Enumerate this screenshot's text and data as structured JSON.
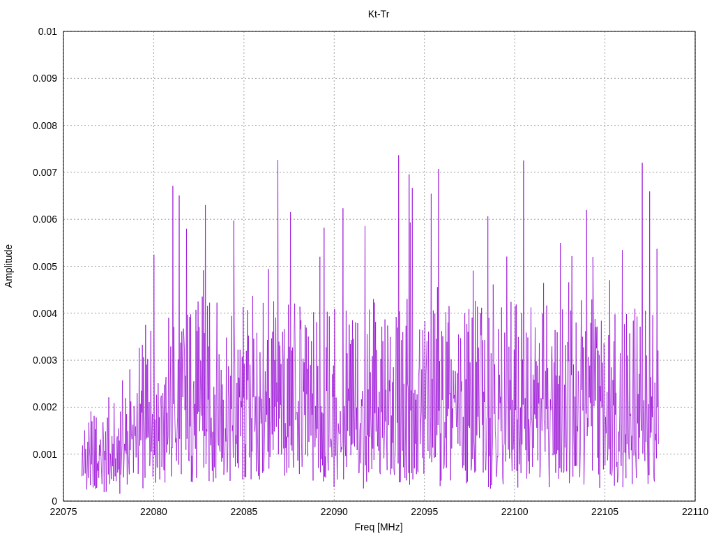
{
  "plot": {
    "chart_data": {
      "type": "line",
      "grid": true,
      "title": "Kt-Tr",
      "xlabel": "Freq [MHz]",
      "ylabel": "Amplitude",
      "xlim": [
        22075,
        22110
      ],
      "ylim": [
        0,
        0.01
      ],
      "xticks": [
        22075,
        22080,
        22085,
        22090,
        22095,
        22100,
        22105,
        22110
      ],
      "yticks": [
        0,
        0.001,
        0.002,
        0.003,
        0.004,
        0.005,
        0.006,
        0.007,
        0.008,
        0.009,
        0.01
      ]
    }
  }
}
